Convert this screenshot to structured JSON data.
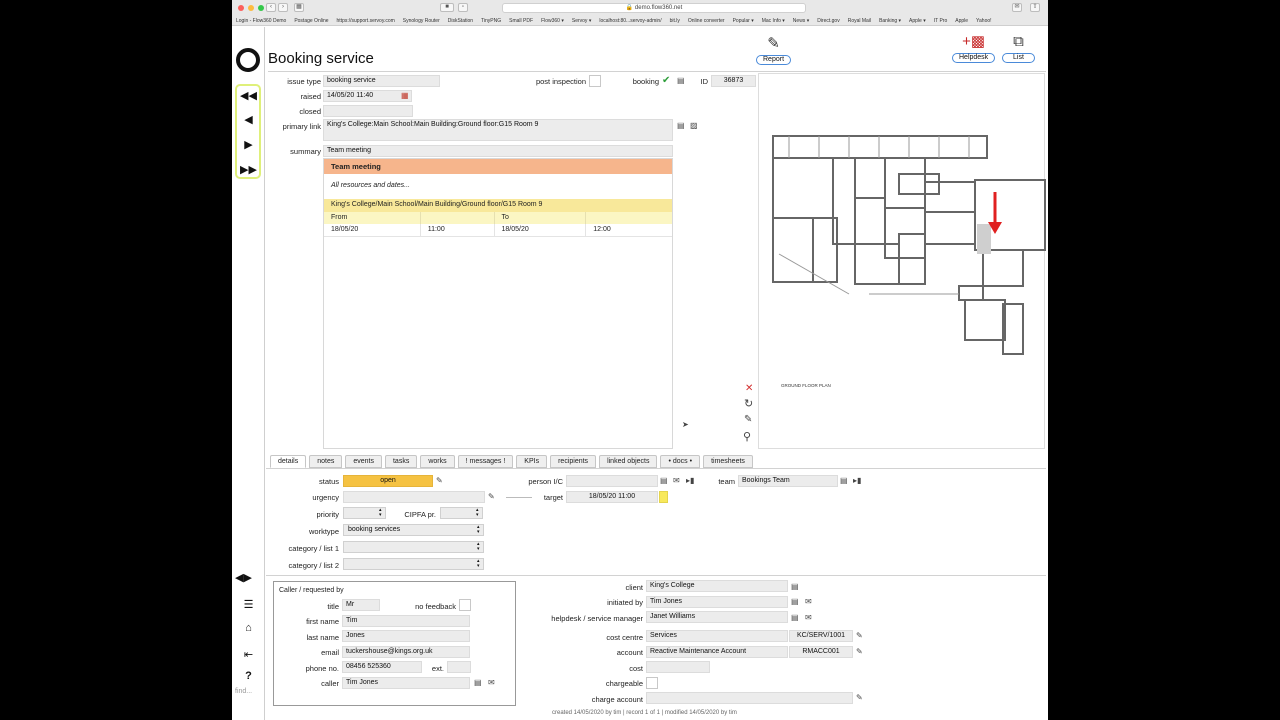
{
  "browser": {
    "url": "demo.flow360.net",
    "bookmarks": [
      "Login - Flow360 Demo",
      "Postage Online",
      "https://support.servoy.com",
      "Synology Router",
      "DiskStation",
      "TinyPNG",
      "Small PDF",
      "Flow360 ▾",
      "Servoy ▾",
      "localhost:80...servoy-admin/",
      "bit.ly",
      "Online converter",
      "Popular ▾",
      "Mac Info ▾",
      "News ▾",
      "Direct.gov",
      "Royal Mail",
      "Banking ▾",
      "Apple ▾",
      "IT Pro",
      "Apple",
      "Yahoo!"
    ]
  },
  "sidebar": {
    "find_placeholder": "find..."
  },
  "header": {
    "title": "Booking service",
    "report_label": "Report",
    "helpdesk_label": "Helpdesk",
    "list_label": "List"
  },
  "form": {
    "issue_type_label": "issue type",
    "issue_type": "booking service",
    "post_inspection_label": "post inspection",
    "booking_label": "booking",
    "id_label": "ID",
    "id": "36873",
    "raised_label": "raised",
    "raised": "14/05/20 11:40",
    "closed_label": "closed",
    "closed": "",
    "primary_link_label": "primary link",
    "primary_link": "King's College:Main School:Main Building:Ground floor:G15 Room 9",
    "summary_label": "summary",
    "summary": "Team meeting"
  },
  "panel": {
    "heading": "Team meeting",
    "subheading": "All resources and dates...",
    "location": "King's College/Main School/Main Building/Ground floor/G15 Room 9",
    "from_label": "From",
    "to_label": "To",
    "from_date": "18/05/20",
    "from_time": "11:00",
    "to_date": "18/05/20",
    "to_time": "12:00"
  },
  "map": {
    "caption": "GROUND FLOOR PLAN"
  },
  "tabs": [
    "details",
    "notes",
    "events",
    "tasks",
    "works",
    "! messages !",
    "KPIs",
    "recipients",
    "linked objects",
    "• docs •",
    "timesheets"
  ],
  "details": {
    "status_label": "status",
    "status": "open",
    "status_color": "#f5c242",
    "urgency_label": "urgency",
    "priority_label": "priority",
    "cipfa_label": "CIPFA pr.",
    "worktype_label": "worktype",
    "worktype": "booking services",
    "cat1_label": "category / list 1",
    "cat2_label": "category / list 2",
    "person_label": "person I/C",
    "target_label": "target",
    "target": "18/05/20 11:00",
    "team_label": "team",
    "team": "Bookings Team"
  },
  "caller": {
    "box_title": "Caller / requested by",
    "title_label": "title",
    "title": "Mr",
    "no_feedback_label": "no feedback",
    "first_name_label": "first name",
    "first_name": "Tim",
    "last_name_label": "last name",
    "last_name": "Jones",
    "email_label": "email",
    "email": "tuckershouse@kings.org.uk",
    "phone_label": "phone no.",
    "phone": "08456 525360",
    "ext_label": "ext.",
    "caller_label": "caller",
    "caller": "Tim Jones"
  },
  "client": {
    "client_label": "client",
    "client": "King's College",
    "initiated_label": "initiated by",
    "initiated": "Tim Jones",
    "manager_label": "helpdesk / service manager",
    "manager": "Janet Williams",
    "cost_centre_label": "cost centre",
    "cost_centre": "Services",
    "cost_centre_code": "KC/SERV/1001",
    "account_label": "account",
    "account": "Reactive Maintenance Account",
    "account_code": "RMACC001",
    "cost_label": "cost",
    "chargeable_label": "chargeable",
    "charge_account_label": "charge account"
  },
  "footer": "created 14/05/2020 by tim | record 1 of 1 | modified 14/05/2020 by tim"
}
